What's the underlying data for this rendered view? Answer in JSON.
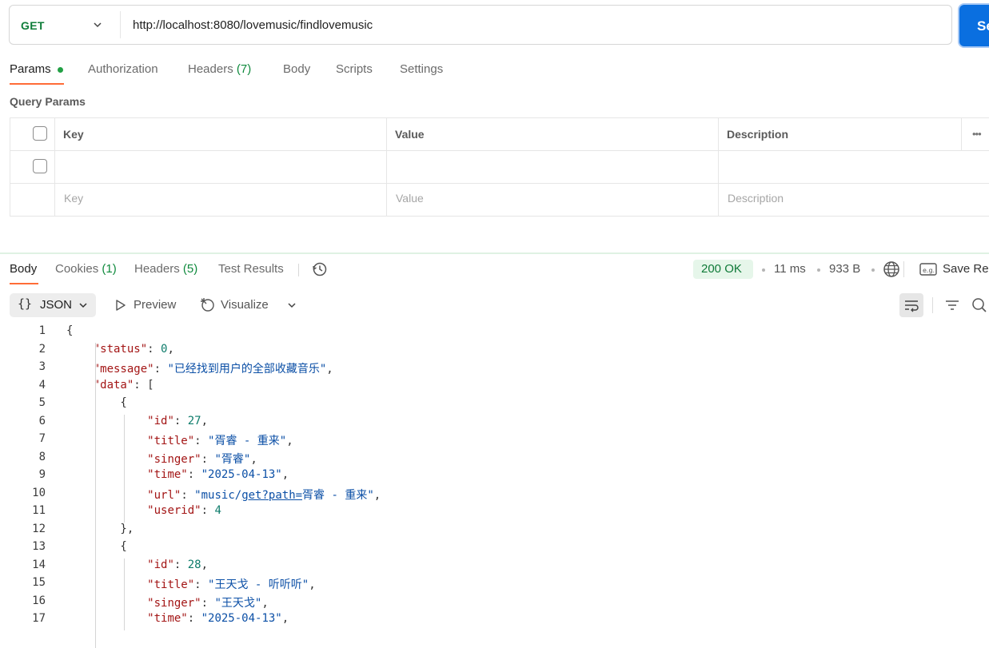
{
  "request": {
    "method": "GET",
    "url": "http://localhost:8080/lovemusic/findlovemusic",
    "send_label": "Se"
  },
  "request_tabs": [
    {
      "label": "Params",
      "count": ""
    },
    {
      "label": "Authorization",
      "count": ""
    },
    {
      "label": "Headers",
      "count": "(7)"
    },
    {
      "label": "Body",
      "count": ""
    },
    {
      "label": "Scripts",
      "count": ""
    },
    {
      "label": "Settings",
      "count": ""
    }
  ],
  "query_params": {
    "title": "Query Params",
    "headers": {
      "key": "Key",
      "value": "Value",
      "description": "Description"
    },
    "placeholders": {
      "key": "Key",
      "value": "Value",
      "description": "Description"
    }
  },
  "response_tabs": [
    {
      "label": "Body",
      "count": ""
    },
    {
      "label": "Cookies",
      "count": "(1)"
    },
    {
      "label": "Headers",
      "count": "(5)"
    },
    {
      "label": "Test Results",
      "count": ""
    }
  ],
  "response_meta": {
    "status": "200 OK",
    "time": "11 ms",
    "size": "933 B",
    "save_label": "Save Re"
  },
  "toolbar": {
    "format": "JSON",
    "preview": "Preview",
    "visualize": "Visualize"
  },
  "code_lines": [
    {
      "n": "1",
      "t": "{"
    },
    {
      "n": "2",
      "t": "    \"status\": 0,"
    },
    {
      "n": "3",
      "t": "    \"message\": \"已经找到用户的全部收藏音乐\","
    },
    {
      "n": "4",
      "t": "    \"data\": ["
    },
    {
      "n": "5",
      "t": "        {"
    },
    {
      "n": "6",
      "t": "            \"id\": 27,"
    },
    {
      "n": "7",
      "t": "            \"title\": \"胥睿 - 重来\","
    },
    {
      "n": "8",
      "t": "            \"singer\": \"胥睿\","
    },
    {
      "n": "9",
      "t": "            \"time\": \"2025-04-13\","
    },
    {
      "n": "10",
      "t": "            \"url\": \"music/get?path=胥睿 - 重来\","
    },
    {
      "n": "11",
      "t": "            \"userid\": 4"
    },
    {
      "n": "12",
      "t": "        },"
    },
    {
      "n": "13",
      "t": "        {"
    },
    {
      "n": "14",
      "t": "            \"id\": 28,"
    },
    {
      "n": "15",
      "t": "            \"title\": \"王天戈 - 听听听\","
    },
    {
      "n": "16",
      "t": "            \"singer\": \"王天戈\","
    },
    {
      "n": "17",
      "t": "            \"time\": \"2025-04-13\","
    }
  ],
  "colors": {
    "accent": "#ff6c37",
    "send": "#0a6fe0",
    "method": "#0f7d3a",
    "status_bg": "#e6f6ea",
    "json_key": "#a31515",
    "json_string": "#0b4fa6",
    "json_number": "#0e7c6b"
  }
}
